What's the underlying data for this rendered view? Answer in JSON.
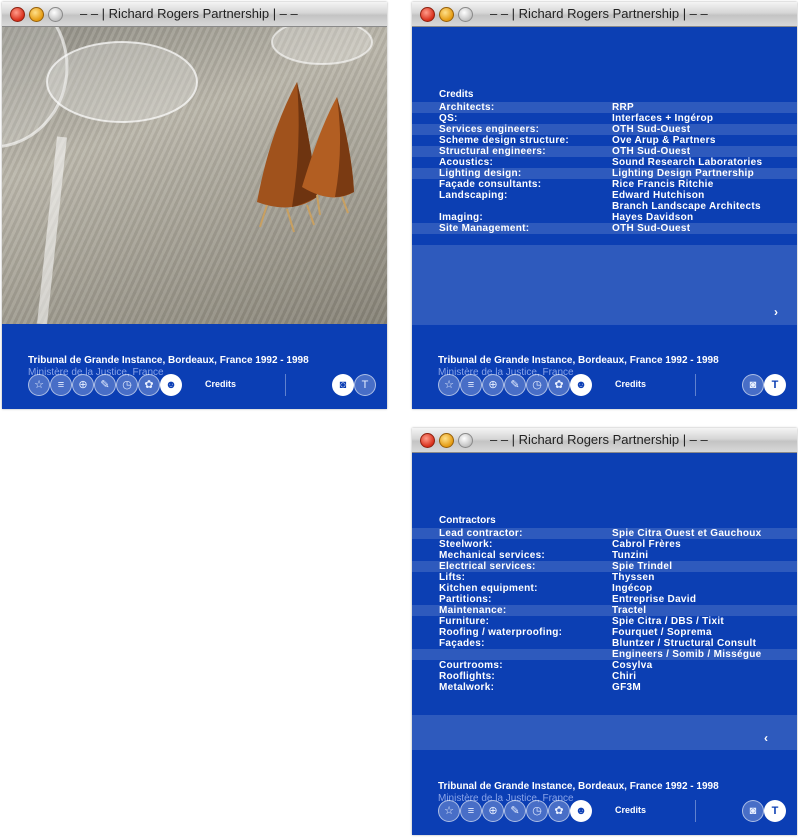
{
  "window_title": "– – | Richard Rogers Partnership | – –",
  "project": {
    "title": "Tribunal de Grande Instance, Bordeaux, France  1992 - 1998",
    "client": "Ministère de la Justice, France"
  },
  "toolbar": {
    "label": "Credits",
    "icons": [
      "star-icon",
      "list-icon",
      "plan-icon",
      "pen-icon",
      "clock-icon",
      "flower-icon",
      "person-icon",
      "camera-icon",
      "text-icon"
    ]
  },
  "credits": {
    "heading": "Credits",
    "rows": [
      [
        "Architects:",
        "RRP"
      ],
      [
        "QS:",
        "Interfaces + Ingérop"
      ],
      [
        "Services engineers:",
        "OTH Sud-Ouest"
      ],
      [
        "Scheme design structure:",
        "Ove Arup & Partners"
      ],
      [
        "Structural engineers:",
        "OTH Sud-Ouest"
      ],
      [
        "Acoustics:",
        "Sound Research Laboratories"
      ],
      [
        "Lighting design:",
        "Lighting Design Partnership"
      ],
      [
        "Façade consultants:",
        "Rice Francis Ritchie"
      ],
      [
        "Landscaping:",
        "Edward Hutchison"
      ],
      [
        "",
        "Branch Landscape Architects"
      ],
      [
        "Imaging:",
        "Hayes Davidson"
      ],
      [
        "Site Management:",
        "OTH Sud-Ouest"
      ]
    ],
    "arrow": "›"
  },
  "contractors": {
    "heading": "Contractors",
    "rows": [
      [
        "Lead contractor:",
        "Spie Citra Ouest et Gauchoux"
      ],
      [
        "Steelwork:",
        "Cabrol Frères"
      ],
      [
        "Mechanical services:",
        "Tunzini"
      ],
      [
        "Electrical services:",
        "Spie Trindel"
      ],
      [
        "Lifts:",
        "Thyssen"
      ],
      [
        "Kitchen equipment:",
        "Ingécop"
      ],
      [
        "Partitions:",
        "Entreprise David"
      ],
      [
        "Maintenance:",
        "Tractel"
      ],
      [
        "Furniture:",
        "Spie Citra / DBS / Tixit"
      ],
      [
        "Roofing / waterproofing:",
        "Fourquet / Soprema"
      ],
      [
        "Façades:",
        "Bluntzer / Structural Consult"
      ],
      [
        "",
        "Engineers / Somib / Misségue"
      ],
      [
        "Courtrooms:",
        "Cosylva"
      ],
      [
        "Rooflights:",
        "Chiri"
      ],
      [
        "Metalwork:",
        "GF3M"
      ]
    ],
    "arrow": "‹"
  }
}
